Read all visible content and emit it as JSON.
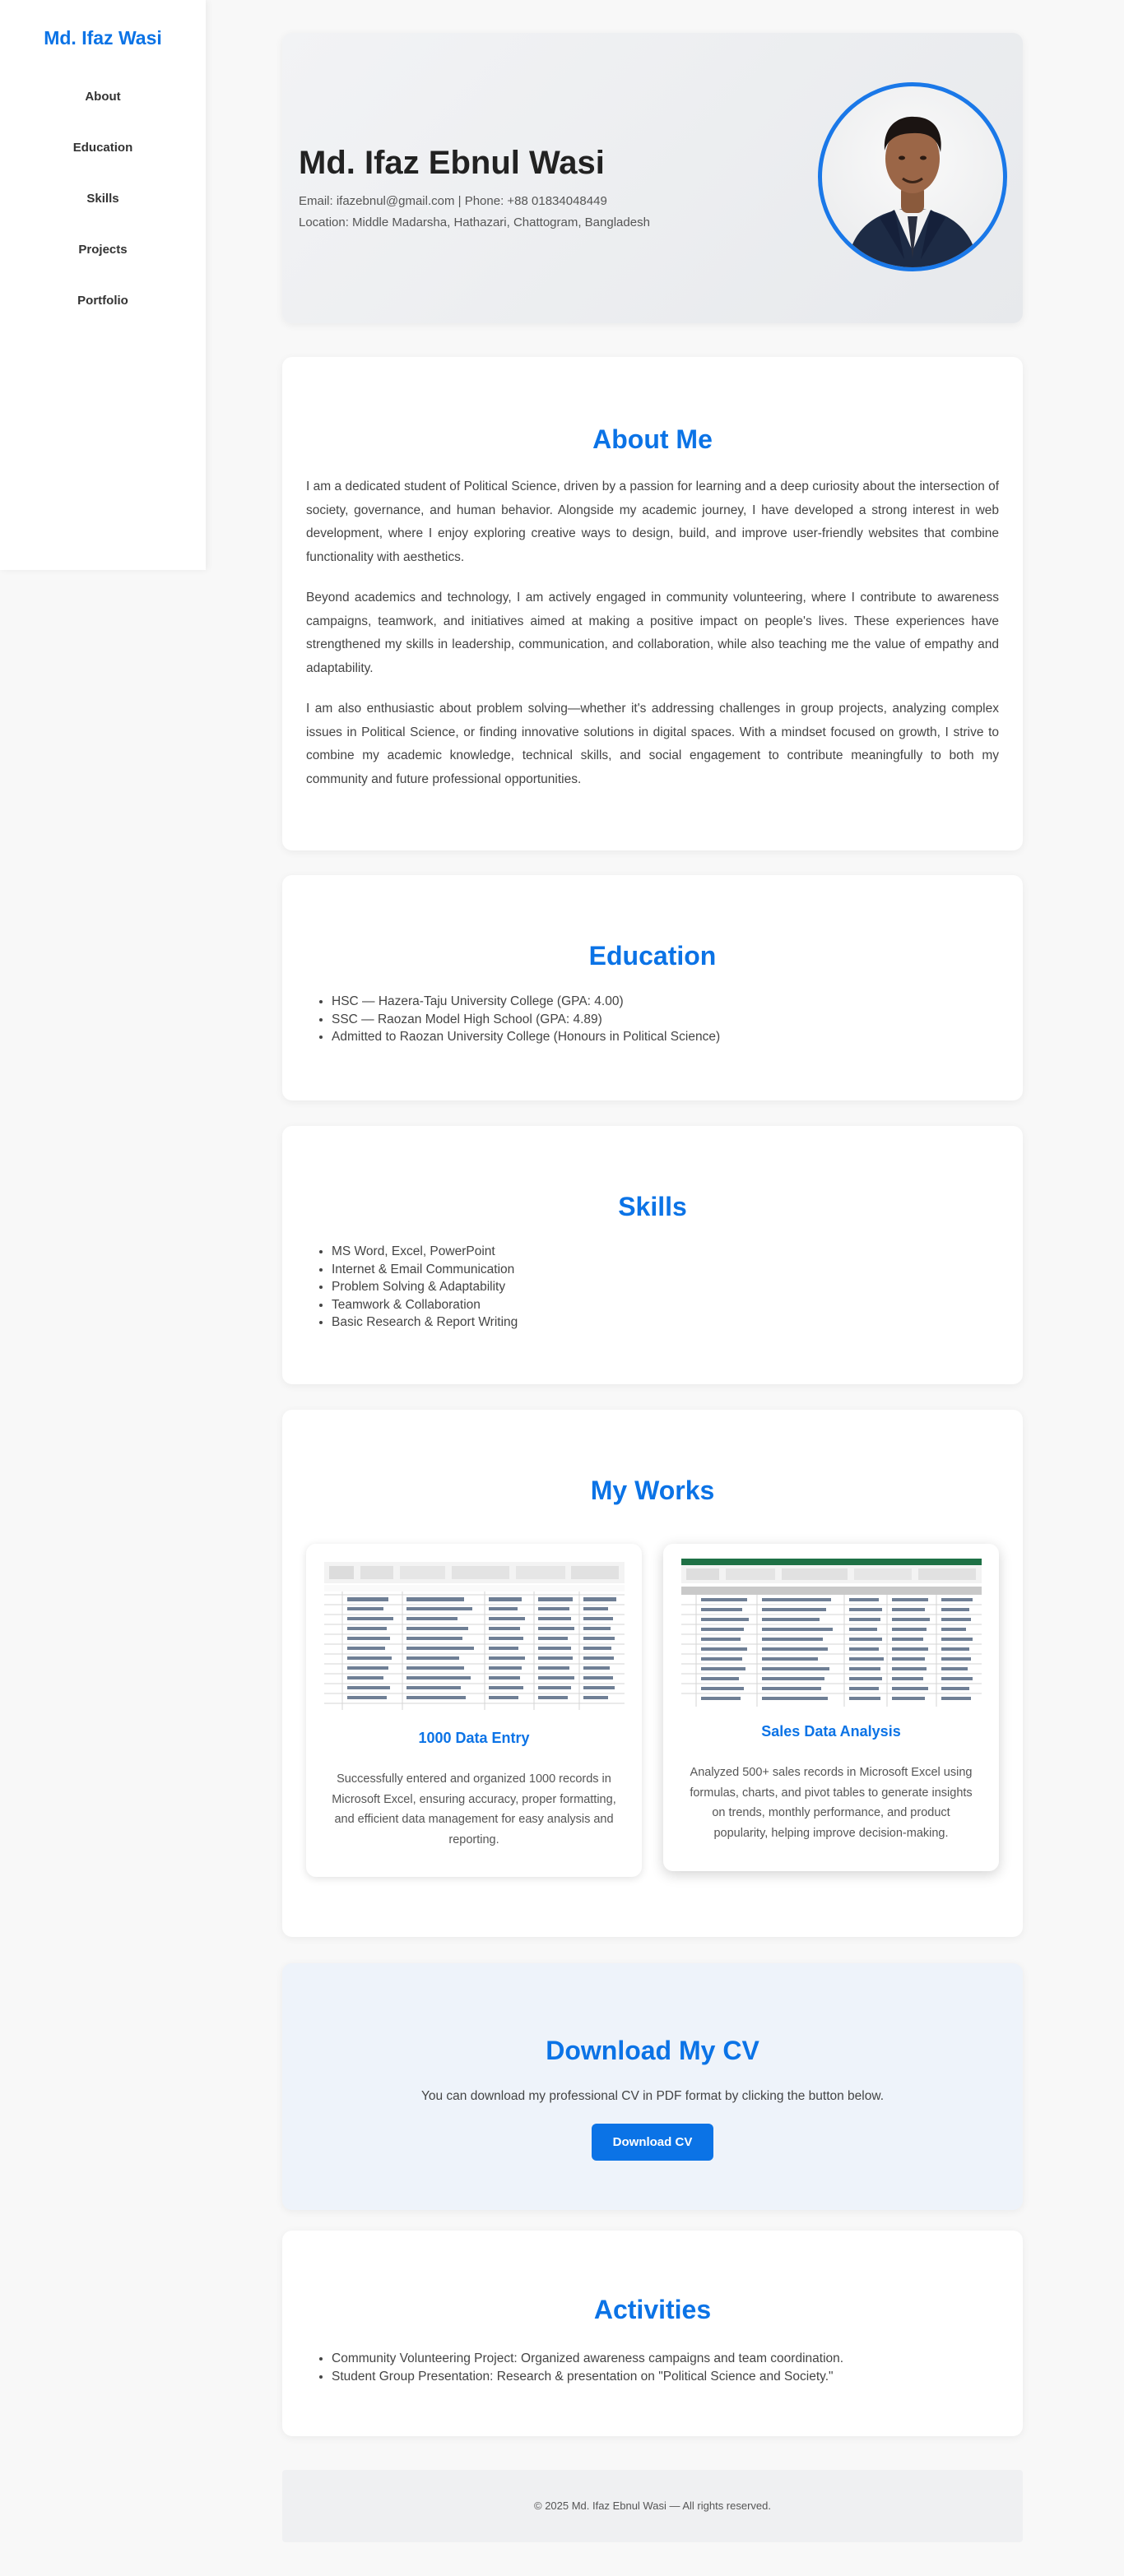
{
  "sidebar": {
    "brand": "Md. Ifaz Wasi",
    "items": [
      {
        "label": "About"
      },
      {
        "label": "Education"
      },
      {
        "label": "Skills"
      },
      {
        "label": "Projects"
      },
      {
        "label": "Portfolio"
      }
    ]
  },
  "hero": {
    "name": "Md. Ifaz Ebnul Wasi",
    "contact": "Email: ifazebnul@gmail.com | Phone: +88 01834048449",
    "location": "Location: Middle Madarsha, Hathazari, Chattogram, Bangladesh"
  },
  "about": {
    "title": "About Me",
    "paragraphs": [
      "I am a dedicated student of Political Science, driven by a passion for learning and a deep curiosity about the intersection of society, governance, and human behavior. Alongside my academic journey, I have developed a strong interest in web development, where I enjoy exploring creative ways to design, build, and improve user-friendly websites that combine functionality with aesthetics.",
      "Beyond academics and technology, I am actively engaged in community volunteering, where I contribute to awareness campaigns, teamwork, and initiatives aimed at making a positive impact on people's lives. These experiences have strengthened my skills in leadership, communication, and collaboration, while also teaching me the value of empathy and adaptability.",
      "I am also enthusiastic about problem solving—whether it's addressing challenges in group projects, analyzing complex issues in Political Science, or finding innovative solutions in digital spaces. With a mindset focused on growth, I strive to combine my academic knowledge, technical skills, and social engagement to contribute meaningfully to both my community and future professional opportunities."
    ]
  },
  "education": {
    "title": "Education",
    "items": [
      "HSC — Hazera-Taju University College (GPA: 4.00)",
      "SSC — Raozan Model High School (GPA: 4.89)",
      "Admitted to Raozan University College (Honours in Political Science)"
    ]
  },
  "skills": {
    "title": "Skills",
    "items": [
      "MS Word, Excel, PowerPoint",
      "Internet & Email Communication",
      "Problem Solving & Adaptability",
      "Teamwork & Collaboration",
      "Basic Research & Report Writing"
    ]
  },
  "works": {
    "title": "My Works",
    "cards": [
      {
        "title": "1000 Data Entry",
        "description": "Successfully entered and organized 1000 records in Microsoft Excel, ensuring accuracy, proper formatting, and efficient data management for easy analysis and reporting."
      },
      {
        "title": "Sales Data Analysis",
        "description": "Analyzed 500+ sales records in Microsoft Excel using formulas, charts, and pivot tables to generate insights on trends, monthly performance, and product popularity, helping improve decision-making."
      }
    ]
  },
  "cv": {
    "title": "Download My CV",
    "text": "You can download my professional CV in PDF format by clicking the button below.",
    "button": "Download CV"
  },
  "activities": {
    "title": "Activities",
    "items": [
      "Community Volunteering Project: Organized awareness campaigns and team coordination.",
      "Student Group Presentation: Research & presentation on \"Political Science and Society.\""
    ]
  },
  "footer": {
    "text": "© 2025 Md. Ifaz Ebnul Wasi — All rights reserved."
  },
  "colors": {
    "accent": "#0b73e6",
    "background": "#f8f8f8",
    "excel_green": "#1e7145"
  }
}
